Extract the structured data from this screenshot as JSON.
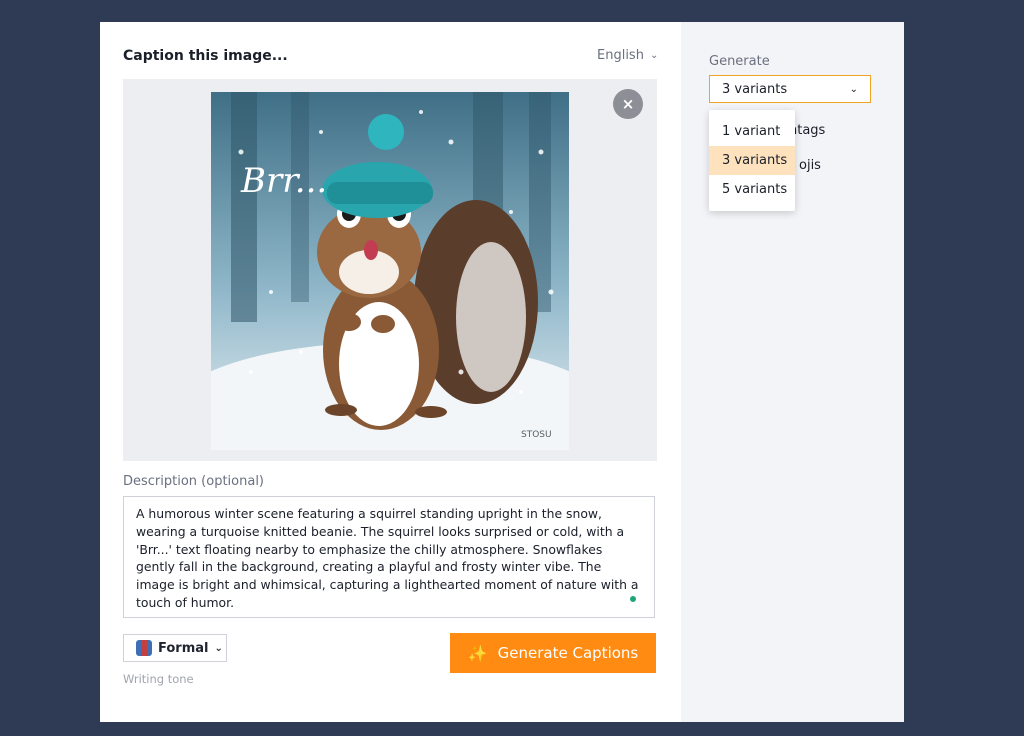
{
  "caption_panel": {
    "title": "Caption this image...",
    "language": "English",
    "description_label": "Description (optional)",
    "description_text": "A humorous winter scene featuring a squirrel standing upright in the snow, wearing a turquoise knitted beanie. The squirrel looks surprised or cold, with a 'Brr...' text floating nearby to emphasize the chilly atmosphere. Snowflakes gently fall in the background, creating a playful and frosty winter vibe. The image is bright and whimsical, capturing a lighthearted moment of nature with a touch of humor.",
    "tone": "Formal",
    "tone_label": "Writing tone",
    "generate_button": "Generate Captions",
    "close_icon": "×"
  },
  "image": {
    "overlay_text": "Brr...",
    "signature": "STOSU"
  },
  "settings": {
    "generate_label": "Generate",
    "selected": "3 variants",
    "options": [
      "1 variant",
      "3 variants",
      "5 variants"
    ],
    "selected_index": 1,
    "hashtags_partial": "htags",
    "emojis_partial": "ojis"
  },
  "colors": {
    "accent": "#ff8b12",
    "background": "#2f3b55",
    "highlight": "#fde2bd"
  }
}
